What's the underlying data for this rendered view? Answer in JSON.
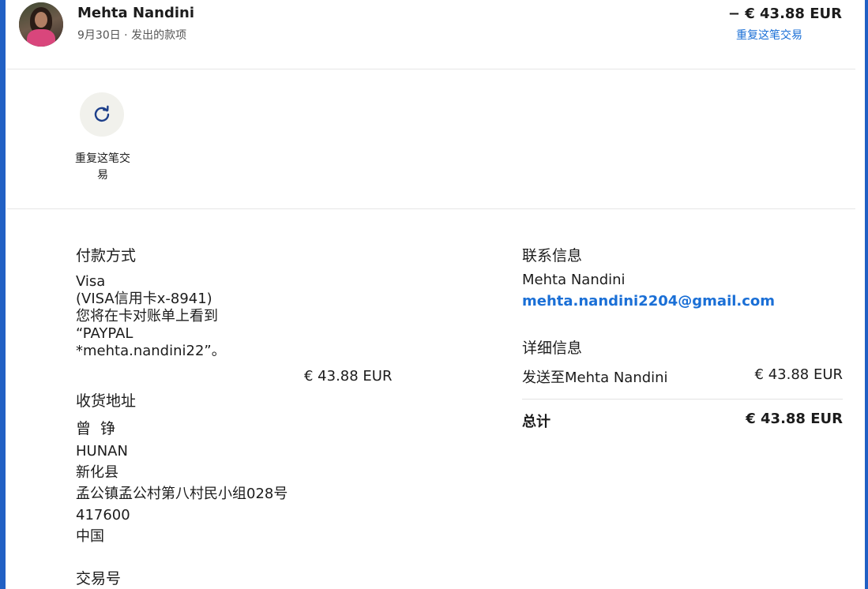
{
  "header": {
    "name": "Mehta Nandini",
    "subline": "9月30日 · 发出的款项",
    "amount": "− € 43.88 EUR",
    "repeat_link": "重复这笔交易"
  },
  "actions": {
    "repeat_label_line1": "重复这笔交",
    "repeat_label_line2": "易",
    "repeat_icon": "refresh-icon"
  },
  "payment": {
    "title": "付款方式",
    "lines": [
      "Visa",
      "(VISA信用卡x-8941)",
      "您将在卡对账单上看到",
      "“PAYPAL",
      "*mehta.nandini22”。"
    ],
    "amount": "€ 43.88 EUR"
  },
  "shipping": {
    "title": "收货地址",
    "name": "曾 铮",
    "lines": [
      "HUNAN",
      "新化县",
      "孟公镇孟公村第八村民小组028号",
      "417600",
      "中国"
    ]
  },
  "transaction": {
    "title": "交易号"
  },
  "contact": {
    "title": "联系信息",
    "name": "Mehta Nandini",
    "email": "mehta.nandini2204@gmail.com"
  },
  "details": {
    "title": "详细信息",
    "sent_to_label": "发送至Mehta Nandini",
    "sent_to_amount": "€ 43.88 EUR",
    "total_label": "总计",
    "total_amount": "€ 43.88 EUR"
  },
  "colors": {
    "accent": "#1a6fd6",
    "frame": "#2160c4"
  }
}
